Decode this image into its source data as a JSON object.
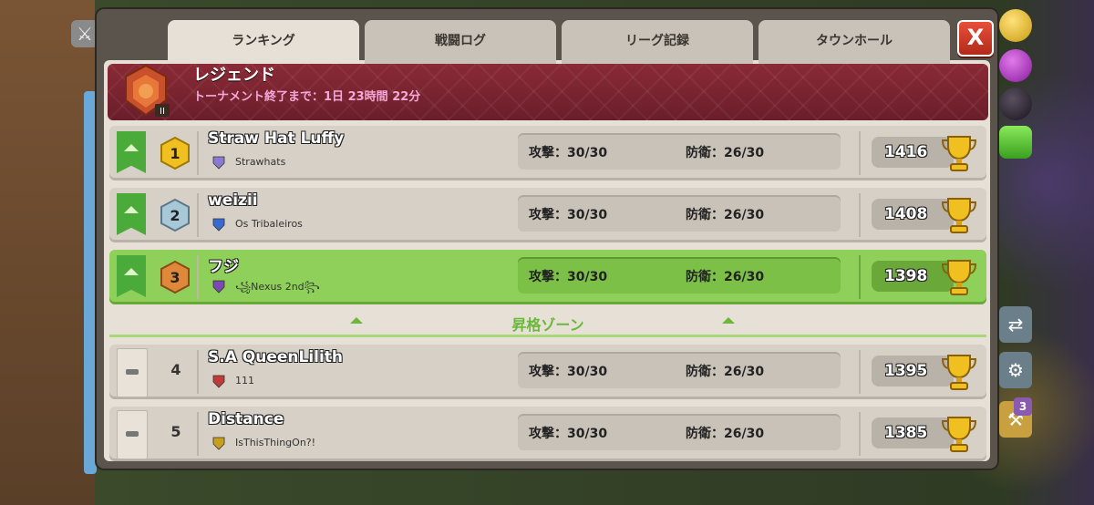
{
  "tabs": [
    {
      "label": "ランキング",
      "active": true
    },
    {
      "label": "戦闘ログ",
      "active": false
    },
    {
      "label": "リーグ記録",
      "active": false
    },
    {
      "label": "タウンホール",
      "active": false
    }
  ],
  "close_label": "X",
  "league": {
    "name": "レジェンド",
    "timer": "トーナメント終了まで：1日 23時間 22分",
    "tier": "II"
  },
  "promotion_zone": "昇格ゾーン",
  "side_badge": "3",
  "players": [
    {
      "rank": "1",
      "name": "Straw Hat Luffy",
      "clan": "Strawhats",
      "attack": "攻撃：30/30",
      "defense": "防衛：26/30",
      "trophies": "1416",
      "status": "up",
      "highlight": false,
      "clan_color": "#8a7ad0"
    },
    {
      "rank": "2",
      "name": "weizii",
      "clan": "Os Tribaleiros",
      "attack": "攻撃：30/30",
      "defense": "防衛：26/30",
      "trophies": "1408",
      "status": "up",
      "highlight": false,
      "clan_color": "#3a6ad0"
    },
    {
      "rank": "3",
      "name": "フジ",
      "clan": "꧁Nexus 2nd꧂",
      "attack": "攻撃：30/30",
      "defense": "防衛：26/30",
      "trophies": "1398",
      "status": "up",
      "highlight": true,
      "clan_color": "#7a4ab0"
    },
    {
      "rank": "4",
      "name": "S.A QueenLilith",
      "clan": "111",
      "attack": "攻撃：30/30",
      "defense": "防衛：26/30",
      "trophies": "1395",
      "status": "same",
      "highlight": false,
      "clan_color": "#c03a3a"
    },
    {
      "rank": "5",
      "name": "Distance",
      "clan": "IsThisThingOn?!",
      "attack": "攻撃：30/30",
      "defense": "防衛：26/30",
      "trophies": "1385",
      "status": "same",
      "highlight": false,
      "clan_color": "#c8a020"
    }
  ]
}
